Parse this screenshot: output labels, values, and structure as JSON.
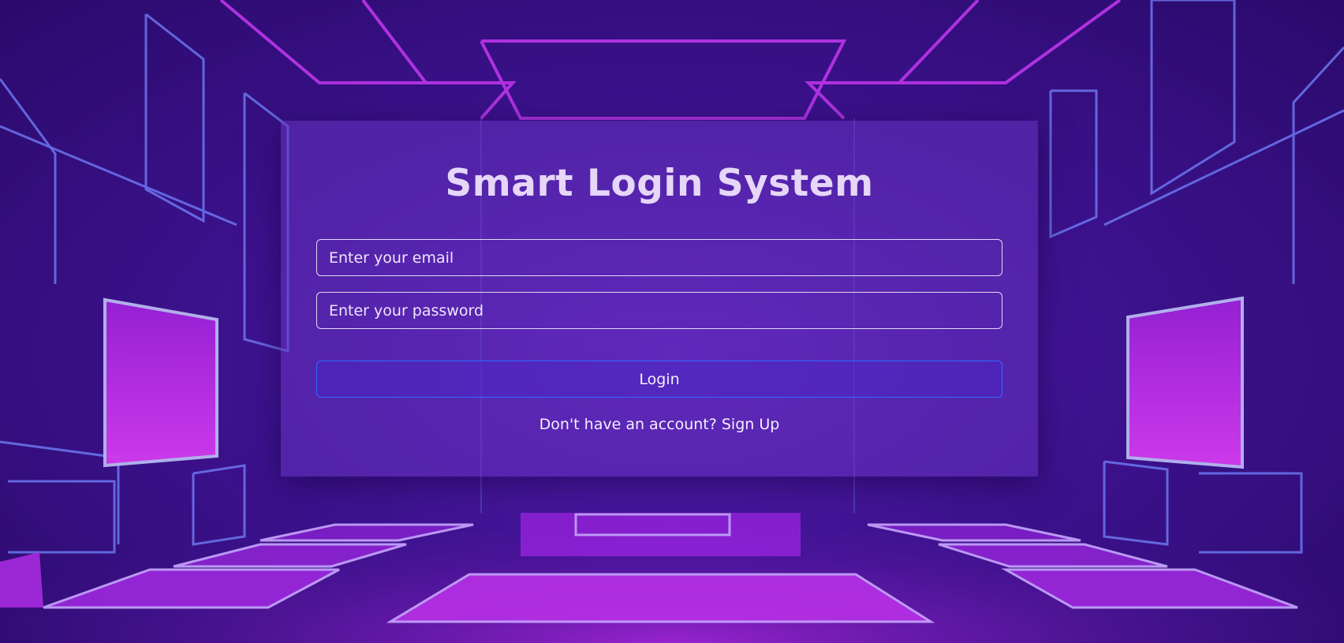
{
  "login": {
    "title": "Smart Login System",
    "email_placeholder": "Enter your email",
    "password_placeholder": "Enter your password",
    "login_label": "Login",
    "signup_prompt": "Don't have an account?",
    "signup_link": "Sign Up"
  },
  "theme": {
    "background": "#3d128f",
    "neon_pink": "#d23cf2",
    "neon_blue": "#6f7df5",
    "button_border": "#2f6bff"
  }
}
